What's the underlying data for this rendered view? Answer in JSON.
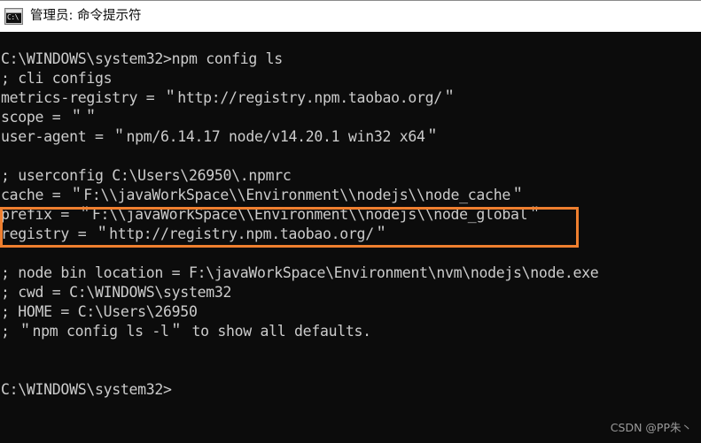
{
  "window": {
    "title": "管理员: 命令提示符",
    "icon_name": "cmd-icon",
    "icon_glyph": "C:\\",
    "titlebar_bg": "#ffffff",
    "console_bg": "#0c0c0c",
    "text_color": "#cccccc"
  },
  "console": {
    "lines": [
      "C:\\WINDOWS\\system32>npm config ls",
      "; cli configs",
      "metrics-registry = ＂http://registry.npm.taobao.org/＂",
      "scope = ＂＂",
      "user-agent = ＂npm/6.14.17 node/v14.20.1 win32 x64＂",
      "",
      "; userconfig C:\\Users\\26950\\.npmrc",
      "cache = ＂F:\\\\javaWorkSpace\\\\Environment\\\\nodejs\\\\node_cache＂",
      "prefix = ＂F:\\\\javaWorkSpace\\\\Environment\\\\nodejs\\\\node_global＂",
      "registry = ＂http://registry.npm.taobao.org/＂",
      "",
      "; node bin location = F:\\javaWorkSpace\\Environment\\nvm\\nodejs\\node.exe",
      "; cwd = C:\\WINDOWS\\system32",
      "; HOME = C:\\Users\\26950",
      "; ＂npm config ls -l＂ to show all defaults.",
      "",
      "",
      "C:\\WINDOWS\\system32>"
    ]
  },
  "annotation": {
    "name": "highlight-box",
    "color": "#ef7f2f",
    "covers_lines": [
      "cache = ＂F:\\\\javaWorkSpace\\\\Environment\\\\nodejs\\\\node_cache＂",
      "prefix = ＂F:\\\\javaWorkSpace\\\\Environment\\\\nodejs\\\\node_global＂"
    ]
  },
  "watermark": {
    "text": "CSDN @PP朱丶"
  }
}
